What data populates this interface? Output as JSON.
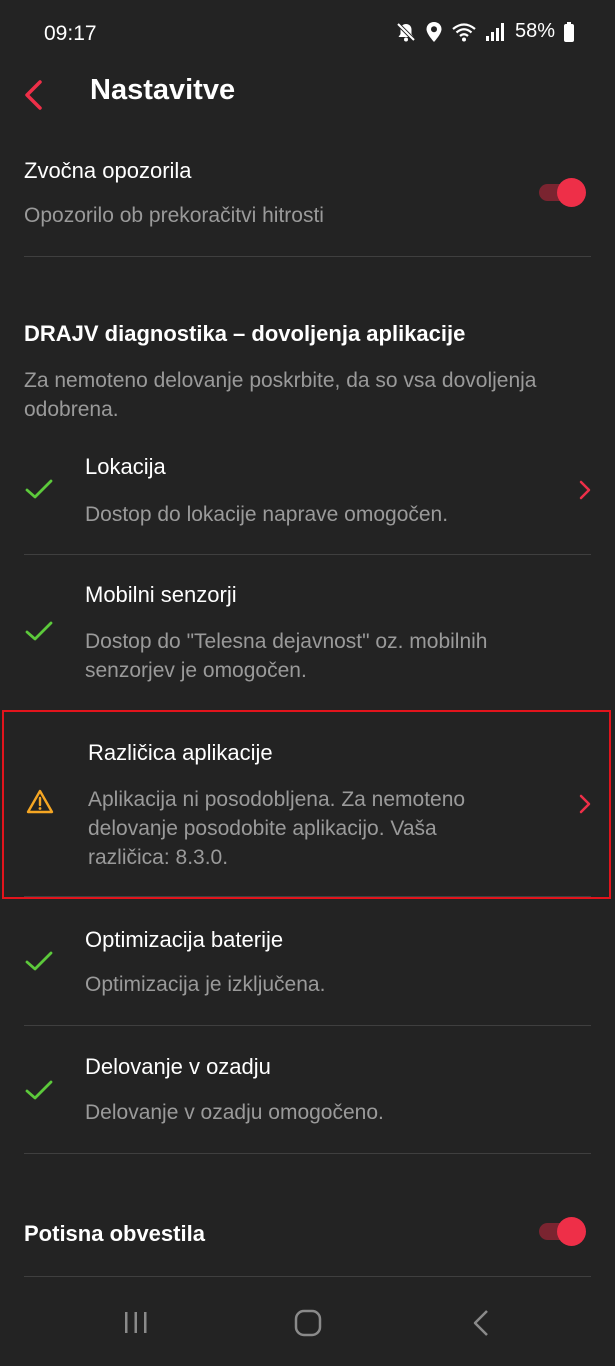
{
  "status_bar": {
    "time": "09:17",
    "battery": "58%",
    "icons": [
      "mute-icon",
      "location-icon",
      "wifi-icon",
      "signal-icon",
      "battery-icon"
    ]
  },
  "header": {
    "title": "Nastavitve",
    "back_icon": "chevron-left-icon"
  },
  "sound_alerts": {
    "title": "Zvočna opozorila",
    "subtitle": "Opozorilo ob prekoračitvi hitrosti",
    "enabled": true
  },
  "diagnostics": {
    "title": "DRAJV diagnostika – dovoljenja aplikacije",
    "description": "Za nemoteno delovanje poskrbite, da so vsa dovoljenja odobrena.",
    "items": [
      {
        "title": "Lokacija",
        "subtitle": "Dostop do lokacije naprave omogočen.",
        "status": "ok",
        "has_chevron": true
      },
      {
        "title": "Mobilni senzorji",
        "subtitle": "Dostop do \"Telesna dejavnost\" oz. mobilnih senzorjev je omogočen.",
        "status": "ok",
        "has_chevron": false
      },
      {
        "title": "Različica aplikacije",
        "subtitle": "Aplikacija ni posodobljena. Za nemoteno delovanje posodobite aplikacijo. Vaša različica: 8.3.0.",
        "status": "warning",
        "has_chevron": true
      },
      {
        "title": "Optimizacija baterije",
        "subtitle": "Optimizacija je izključena.",
        "status": "ok",
        "has_chevron": false
      },
      {
        "title": "Delovanje v ozadju",
        "subtitle": "Delovanje v ozadju omogočeno.",
        "status": "ok",
        "has_chevron": false
      }
    ]
  },
  "push_notifications": {
    "title": "Potisna obvestila",
    "enabled": true
  },
  "colors": {
    "background": "#232323",
    "accent": "#ee2f48",
    "ok": "#5cc93b",
    "warning": "#f5a623",
    "highlight": "#e2141c"
  },
  "nav_bar": {
    "buttons": [
      "recent-apps-icon",
      "home-icon",
      "back-icon"
    ]
  }
}
